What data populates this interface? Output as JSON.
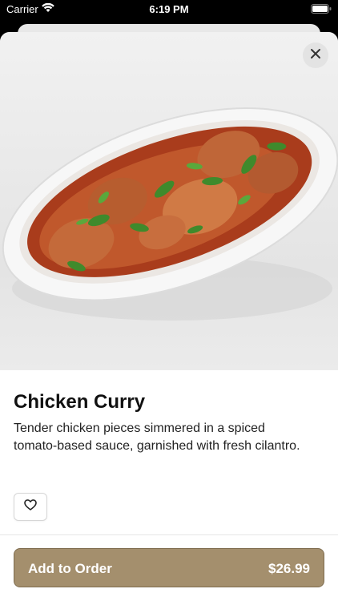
{
  "status_bar": {
    "carrier": "Carrier",
    "time": "6:19 PM"
  },
  "item": {
    "name": "Chicken Curry",
    "description": "Tender chicken pieces simmered in a spiced tomato-based sauce, garnished with fresh cilantro."
  },
  "icons": {
    "close": "close-icon",
    "favorite": "heart-outline-icon",
    "wifi": "wifi-icon",
    "battery": "battery-icon"
  },
  "order_button": {
    "label": "Add to Order",
    "price": "$26.99"
  },
  "colors": {
    "accent": "#a48f6d",
    "accent_border": "#7f6d50"
  }
}
